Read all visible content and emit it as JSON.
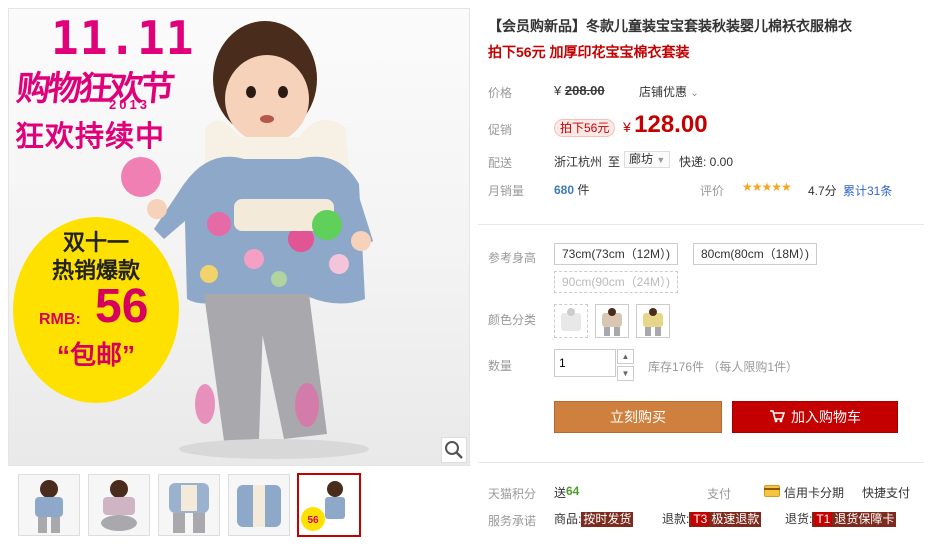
{
  "product": {
    "title": "【会员购新品】冬款儿童装宝宝套装秋装婴儿棉袄衣服棉衣",
    "subtitle": "拍下56元 加厚印花宝宝棉衣套装"
  },
  "promo_image": {
    "event_number": "11.11",
    "event_title": "购物狂欢节",
    "event_year": "2013",
    "banner": "狂欢持续中",
    "badge_line1": "双十一",
    "badge_line2": "热销爆款",
    "badge_price_prefix": "RMB:",
    "badge_price": "56",
    "badge_shipping": "“包邮”"
  },
  "price": {
    "label": "价格",
    "currency": "¥",
    "original": "208.00",
    "store_discount": "店铺优惠"
  },
  "promotion": {
    "label": "促销",
    "tag": "拍下56元",
    "currency": "¥",
    "value": "128.00"
  },
  "shipping": {
    "label": "配送",
    "from": "浙江杭州",
    "to_word": "至",
    "destination": "廊坊",
    "fee": "快递: 0.00"
  },
  "sales": {
    "label": "月销量",
    "count": "680",
    "unit": "件",
    "rating_label": "评价",
    "stars": "★★★★★",
    "rating": 4.7,
    "rating_text": "4.7分",
    "reviews": "累计31条"
  },
  "size": {
    "label": "参考身高",
    "options": [
      "73cm(73cm（12M）)",
      "80cm(80cm（18M）)",
      "90cm(90cm（24M）)"
    ]
  },
  "color": {
    "label": "颜色分类"
  },
  "quantity": {
    "label": "数量",
    "value": "1",
    "stock": "库存176件 （每人限购1件）"
  },
  "actions": {
    "buy_now": "立刻购买",
    "add_to_cart": "加入购物车"
  },
  "points": {
    "label": "天猫积分",
    "give": "送",
    "value": "64",
    "pay_label": "支付",
    "credit_card": "信用卡分期",
    "quick_pay": "快捷支付"
  },
  "service": {
    "label": "服务承诺",
    "item1_label": "商品:",
    "item1_tag": "按时发货",
    "item2_label": "退款:",
    "item2_code": "T3",
    "item2_tag": "极速退款",
    "item3_label": "退货:",
    "item3_code": "T1",
    "item3_tag": "退货保障卡"
  },
  "colors": {
    "brand_red": "#c40000",
    "buy_now_bg": "#d0803e",
    "cart_bg": "#c40000",
    "link_blue": "#3366cc"
  }
}
